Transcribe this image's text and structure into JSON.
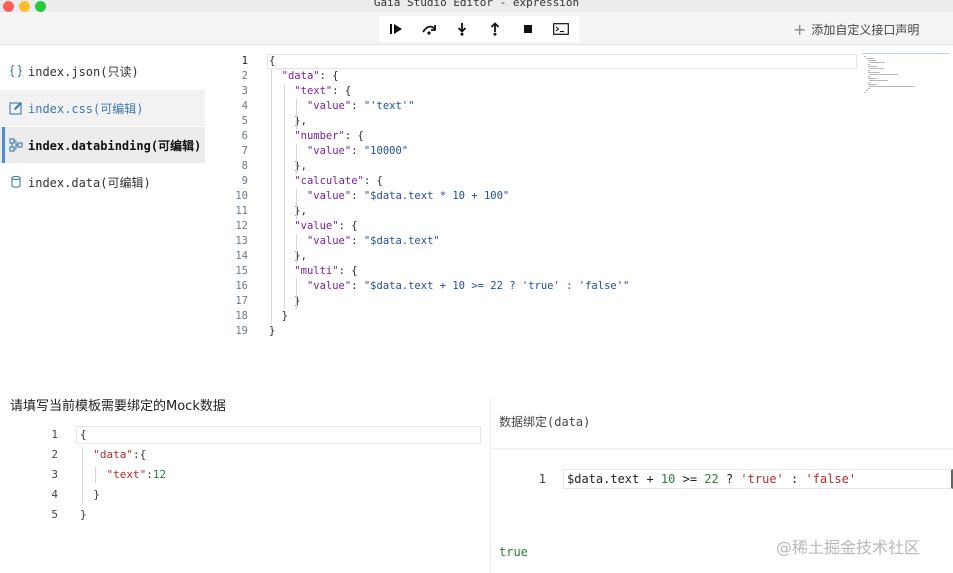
{
  "window": {
    "title": "Gaia Studio Editor - expression"
  },
  "toolbar": {
    "debug_buttons": [
      "continue-icon",
      "step-over-icon",
      "step-into-icon",
      "step-out-icon",
      "stop-icon",
      "console-icon"
    ],
    "add_interface_label": "添加自定义接口声明"
  },
  "sidebar": {
    "items": [
      {
        "label": "index.json(只读)",
        "icon": "braces-icon"
      },
      {
        "label": "index.css(可编辑)",
        "icon": "edit-icon"
      },
      {
        "label": "index.databinding(可编辑)",
        "icon": "nodes-icon"
      },
      {
        "label": "index.data(可编辑)",
        "icon": "database-icon"
      }
    ]
  },
  "editor": {
    "lines": [
      "{",
      "  \"data\": {",
      "    \"text\": {",
      "      \"value\": \"'text'\"",
      "    },",
      "    \"number\": {",
      "      \"value\": \"10000\"",
      "    },",
      "    \"calculate\": {",
      "      \"value\": \"$data.text * 10 + 100\"",
      "    },",
      "    \"value\": {",
      "      \"value\": \"$data.text\"",
      "    },",
      "    \"multi\": {",
      "      \"value\": \"$data.text + 10 >= 22 ? 'true' : 'false'\"",
      "    }",
      "  }",
      "}"
    ]
  },
  "mock": {
    "title": "请填写当前模板需要绑定的Mock数据",
    "lines": [
      "{",
      "  \"data\":{",
      "    \"text\":12",
      "  }",
      "}"
    ]
  },
  "binding": {
    "label": "数据绑定(data)",
    "line_number": "1",
    "expression": "$data.text + 10 >= 22 ? 'true' : 'false'",
    "result": "true"
  },
  "watermark": "@稀土掘金技术社区"
}
